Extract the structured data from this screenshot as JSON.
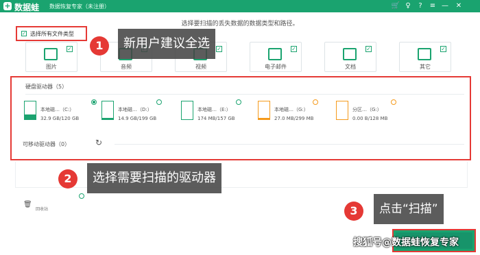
{
  "titlebar": {
    "app_name": "数据蛙",
    "subtitle": "数据恢复专家（未注册）",
    "controls": [
      "cart-icon",
      "account-icon",
      "help-icon",
      "menu-icon",
      "minimize-icon",
      "close-icon"
    ]
  },
  "subheader": "选择要扫描的丢失数据的数据类型和路径。",
  "select_all": {
    "label": "选择所有文件类型",
    "checked": true
  },
  "file_types": [
    {
      "label": "图片",
      "icon": "image-icon",
      "checked": true
    },
    {
      "label": "音频",
      "icon": "audio-icon",
      "checked": true
    },
    {
      "label": "视频",
      "icon": "video-icon",
      "checked": true
    },
    {
      "label": "电子邮件",
      "icon": "email-icon",
      "checked": true
    },
    {
      "label": "文档",
      "icon": "document-icon",
      "checked": true
    },
    {
      "label": "其它",
      "icon": "others-icon",
      "checked": true
    }
  ],
  "drives_section": {
    "title": "硬盘驱动器（5）",
    "drives": [
      {
        "name": "本地磁…（C:）",
        "size": "32.9 GB/120 GB",
        "selected": true,
        "color": "#1aa36f",
        "fill": 0.27
      },
      {
        "name": "本地磁…（D:）",
        "size": "14.9 GB/199 GB",
        "selected": false,
        "color": "#1aa36f",
        "fill": 0.07
      },
      {
        "name": "本地磁…（E:）",
        "size": "174 MB/157 GB",
        "selected": false,
        "color": "#1aa36f",
        "fill": 0.0
      },
      {
        "name": "本地磁…（G:）",
        "size": "27.0 MB/299 MB",
        "selected": false,
        "color": "#f59a1b",
        "fill": 0.09
      },
      {
        "name": "分区…（G:）",
        "size": "0.00  B/128 MB",
        "selected": false,
        "color": "#f59a1b",
        "fill": 0.0
      }
    ],
    "removable": "可移动驱动器（0）"
  },
  "recycle_bin": "回收站",
  "callouts": [
    {
      "number": "1",
      "text": "新用户建议全选"
    },
    {
      "number": "2",
      "text": "选择需要扫描的驱动器"
    },
    {
      "number": "3",
      "text": "点击“扫描”"
    }
  ],
  "watermark": "搜狐号@数据蛙恢复专家"
}
